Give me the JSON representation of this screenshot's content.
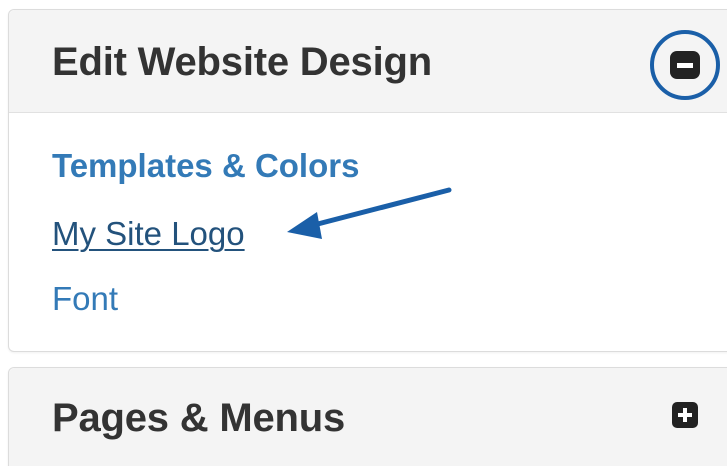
{
  "panels": [
    {
      "title": "Edit Website Design",
      "toggle_icon": "minus-square-icon",
      "expanded": true,
      "links": [
        {
          "label": "Templates & Colors",
          "state": "active"
        },
        {
          "label": "My Site Logo",
          "state": "hover"
        },
        {
          "label": "Font",
          "state": "default"
        }
      ]
    },
    {
      "title": "Pages & Menus",
      "toggle_icon": "plus-square-icon",
      "expanded": false
    }
  ],
  "annotation": {
    "type": "arrow",
    "points_to": "My Site Logo",
    "color": "#1a5fa8"
  },
  "colors": {
    "link": "#337ab7",
    "link_hover": "#23527c",
    "header_bg": "#f4f4f4",
    "title": "#333333",
    "highlight": "#1a5fa8"
  }
}
